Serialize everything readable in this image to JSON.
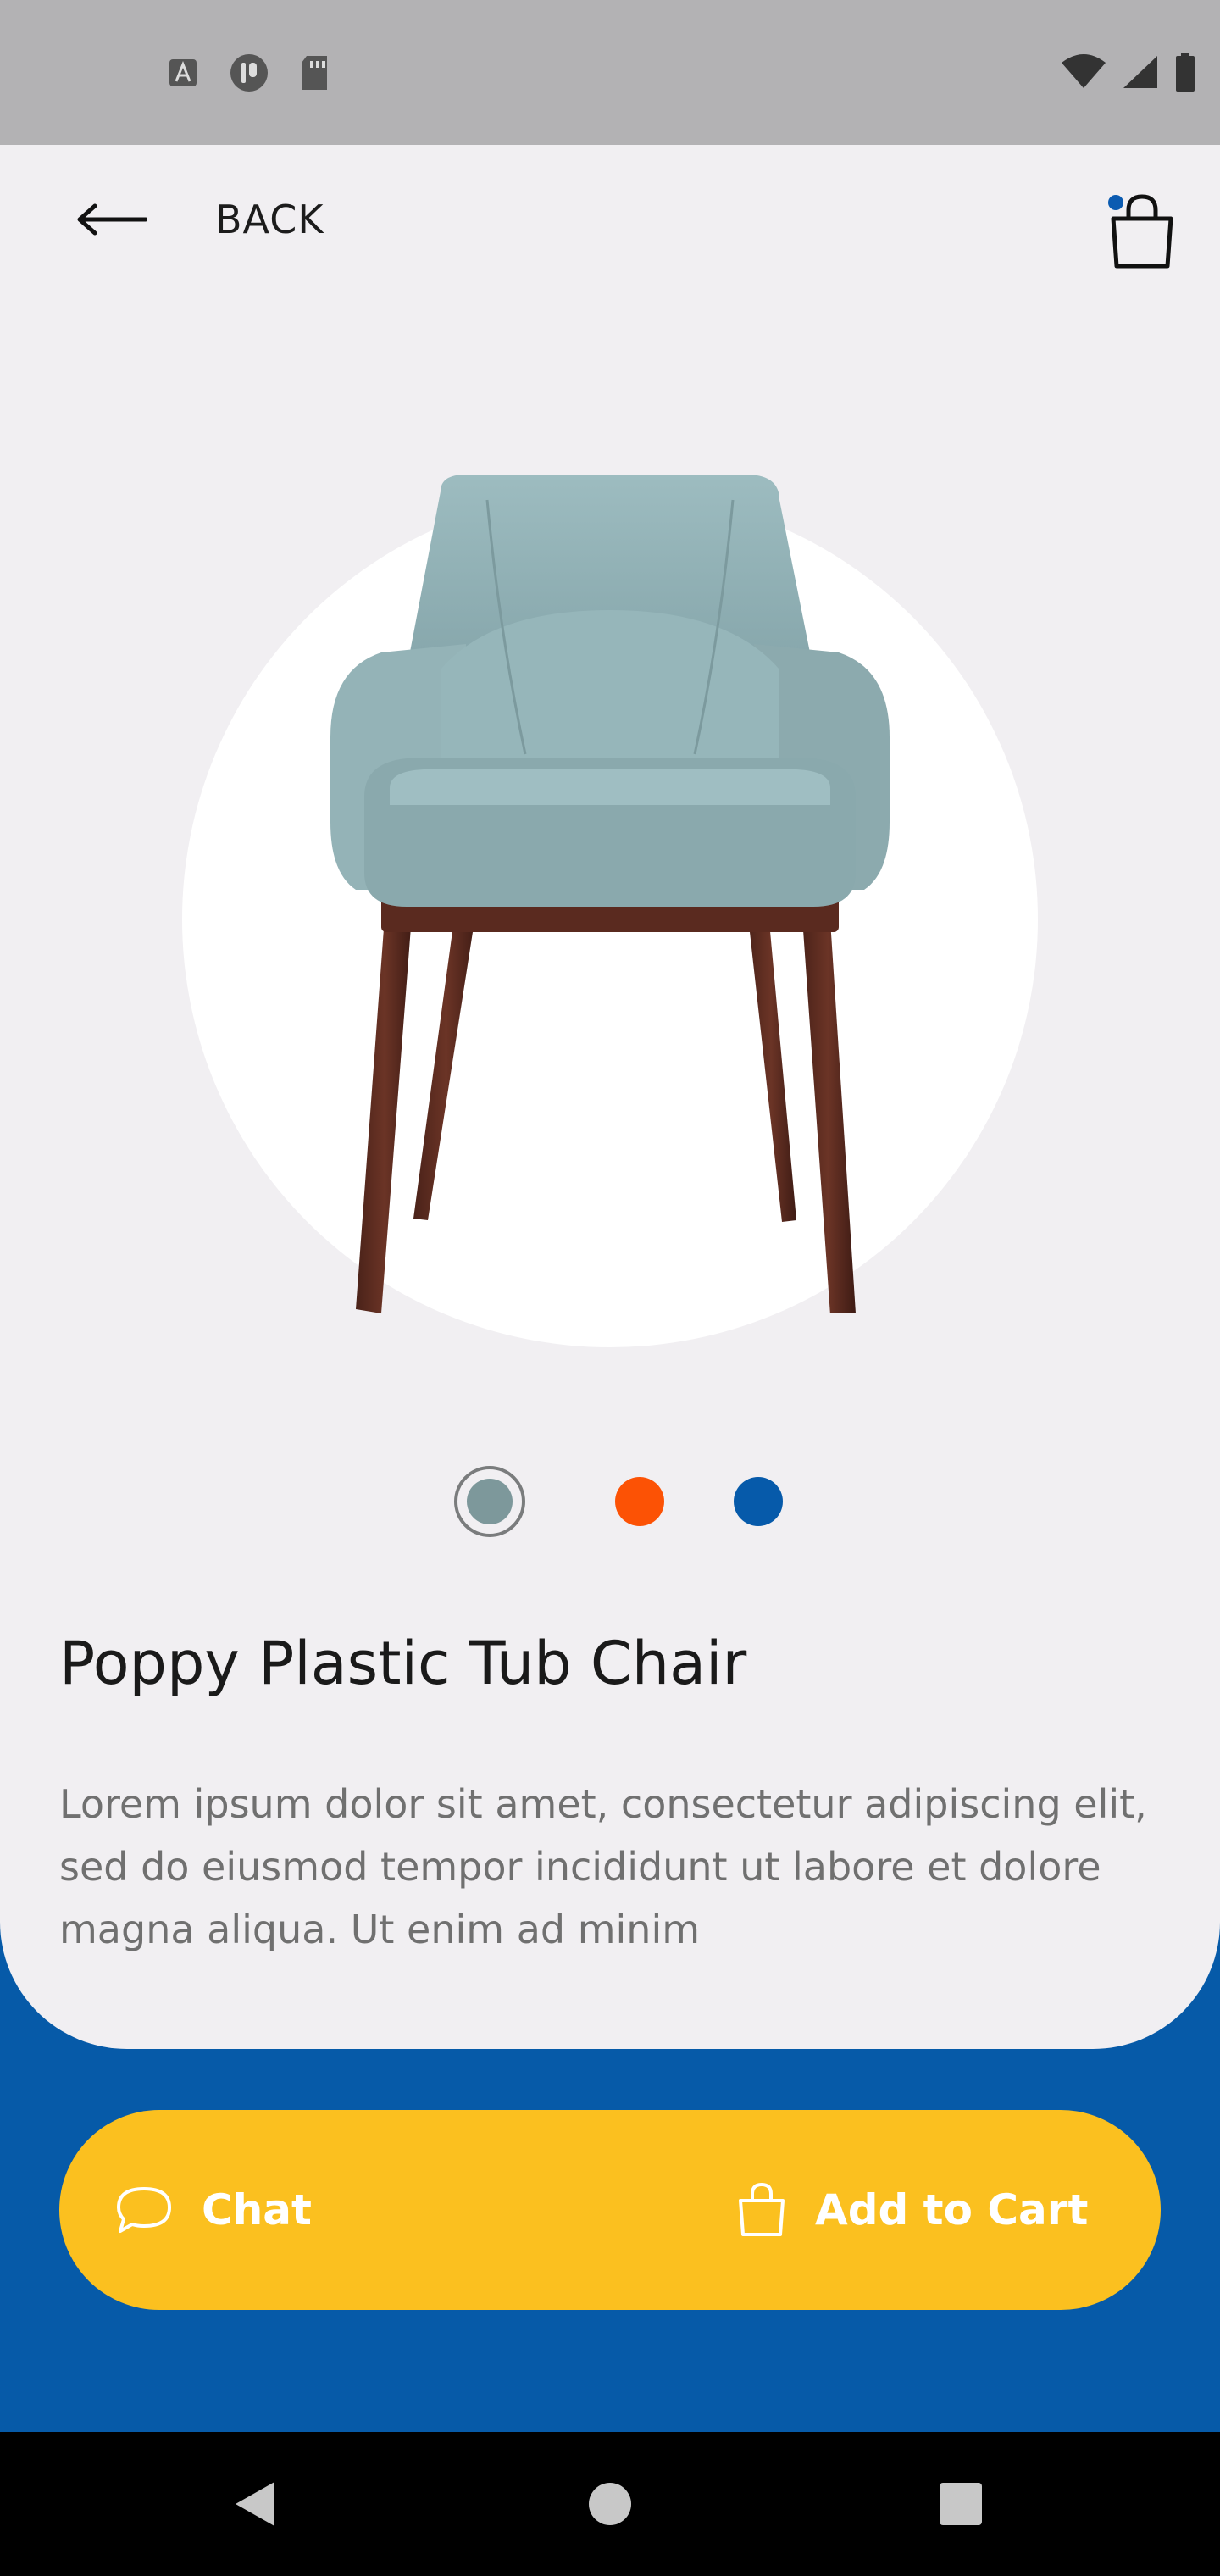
{
  "status_bar": {
    "left_icons": [
      "font-notification-icon",
      "app-notification-icon",
      "sd-card-icon"
    ],
    "right_icons": [
      "wifi-icon",
      "cellular-signal-icon",
      "battery-icon"
    ]
  },
  "header": {
    "back_label": "BACK",
    "back_icon": "arrow-left-icon",
    "cart_icon": "shopping-bag-icon",
    "cart_badge_color": "#0b5bb1"
  },
  "product": {
    "title": "Poppy Plastic Tub Chair",
    "description": "Lorem ipsum dolor sit amet, consectetur adipiscing elit, sed do eiusmod tempor incididunt ut labore et dolore magna aliqua. Ut enim ad minim",
    "image": "armchair-image",
    "colors": [
      "#7d989b",
      "#fc5205",
      "#065aaa"
    ],
    "selected_color_index": 0
  },
  "actions": {
    "chat_label": "Chat",
    "chat_icon": "chat-bubble-icon",
    "add_to_cart_label": "Add to Cart",
    "add_to_cart_icon": "shopping-bag-icon"
  },
  "theme": {
    "background": "#065aa8",
    "card": "#f1eff2",
    "accent": "#fbc01f"
  },
  "nav_bar": {
    "icons": [
      "back-triangle-icon",
      "home-circle-icon",
      "recents-square-icon"
    ]
  }
}
